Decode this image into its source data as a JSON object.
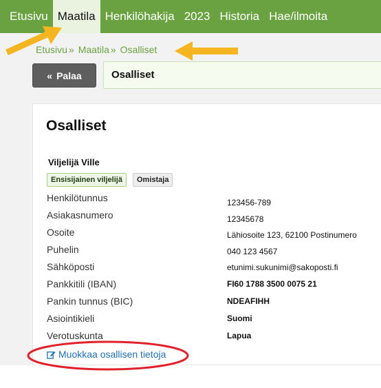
{
  "nav": {
    "items": [
      {
        "label": "Etusivu"
      },
      {
        "label": "Maatila"
      },
      {
        "label": "Henkilöhakija"
      },
      {
        "label": "2023"
      },
      {
        "label": "Historia"
      },
      {
        "label": "Hae/ilmoita"
      }
    ],
    "active_index": 1
  },
  "breadcrumb": {
    "items": [
      "Etusivu",
      "Maatila",
      "Osalliset"
    ],
    "separator": "»"
  },
  "back_button": {
    "icon": "double-chevron-left-icon",
    "label": "Palaa"
  },
  "page_header": {
    "title": "Osalliset"
  },
  "card": {
    "title": "Osalliset",
    "person": {
      "name": "Viljelijä Ville",
      "badges": [
        "Ensisijainen viljelijä",
        "Omistaja"
      ]
    },
    "details": [
      {
        "label": "Henkilötunnus",
        "value": "123456-789"
      },
      {
        "label": "Asiakasnumero",
        "value": "12345678"
      },
      {
        "label": "Osoite",
        "value": "Lähiosoite 123, 62100 Postinumero"
      },
      {
        "label": "Puhelin",
        "value": "040 123 4567"
      },
      {
        "label": "Sähköposti",
        "value": "etunimi.sukunimi@sakoposti.fi"
      },
      {
        "label": "Pankkitili (IBAN)",
        "value": "FI60 1788 3500 0075 21"
      },
      {
        "label": "Pankin tunnus (BIC)",
        "value": "NDEAFIHH"
      },
      {
        "label": "Asiointikieli",
        "value": "Suomi"
      },
      {
        "label": "Verotuskunta",
        "value": "Lapua"
      }
    ],
    "edit_link": {
      "icon": "edit-icon",
      "label": "Muokkaa osallisen tietoja"
    }
  },
  "colors": {
    "nav_bg": "#6aa241",
    "nav_active_bg": "#e9f3e0",
    "link": "#1f6fb3",
    "annotation_arrow": "#f5b520",
    "annotation_oval": "#e0202a"
  }
}
